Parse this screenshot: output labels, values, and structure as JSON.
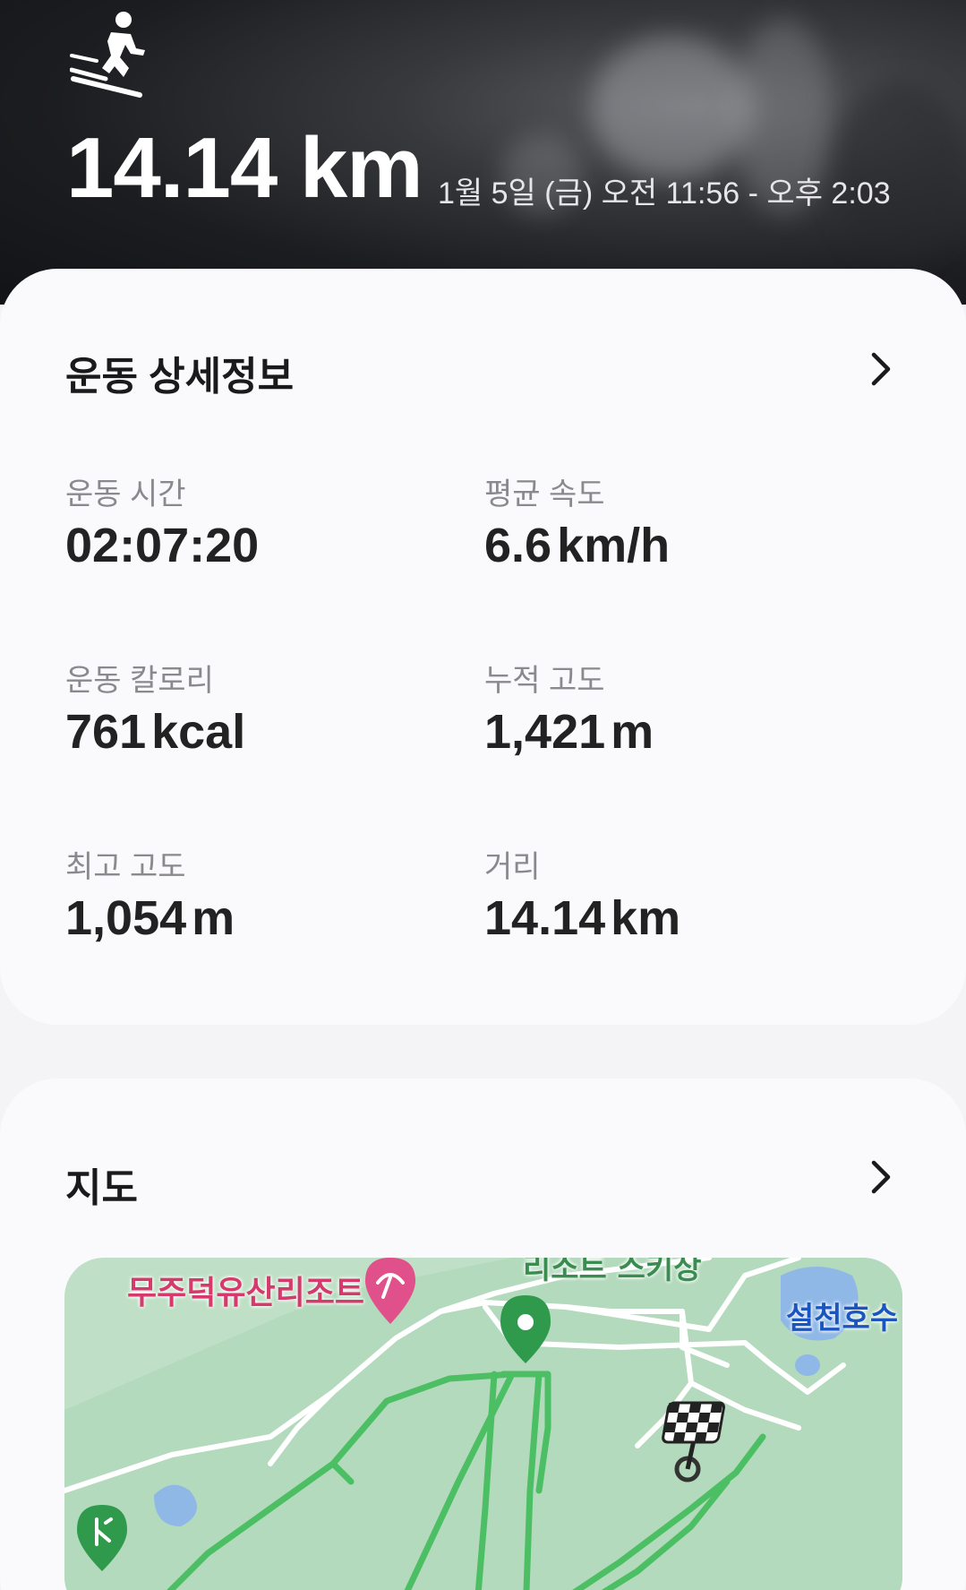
{
  "hero": {
    "activity_icon": "skiing-icon",
    "distance_value": "14.14",
    "distance_unit": "km",
    "time_range": "1월 5일 (금) 오전 11:56 - 오후 2:03"
  },
  "detail": {
    "title": "운동 상세정보",
    "stats": [
      {
        "label": "운동 시간",
        "value": "02:07:20",
        "unit": ""
      },
      {
        "label": "평균 속도",
        "value": "6.6",
        "unit": "km/h"
      },
      {
        "label": "운동 칼로리",
        "value": "761",
        "unit": "kcal"
      },
      {
        "label": "누적 고도",
        "value": "1,421",
        "unit": "m"
      },
      {
        "label": "최고 고도",
        "value": "1,054",
        "unit": "m"
      },
      {
        "label": "거리",
        "value": "14.14",
        "unit": "km"
      }
    ]
  },
  "map": {
    "title": "지도",
    "labels": {
      "resort": "무주덕유산리조트",
      "ski": "리소트 스키상",
      "lake": "설천호수"
    },
    "colors": {
      "route": "#4cbf64",
      "resort_pin": "#e0508a",
      "start_pin": "#2f9a4c",
      "lake_label": "#1a55c0"
    }
  },
  "icons": {
    "detail_chevron": "chevron-right-icon",
    "map_chevron": "chevron-right-icon",
    "start_marker": "start-pin-icon",
    "finish_marker": "finish-flag-icon",
    "resort_marker": "umbrella-pin-icon",
    "golf_marker": "golf-pin-icon"
  }
}
